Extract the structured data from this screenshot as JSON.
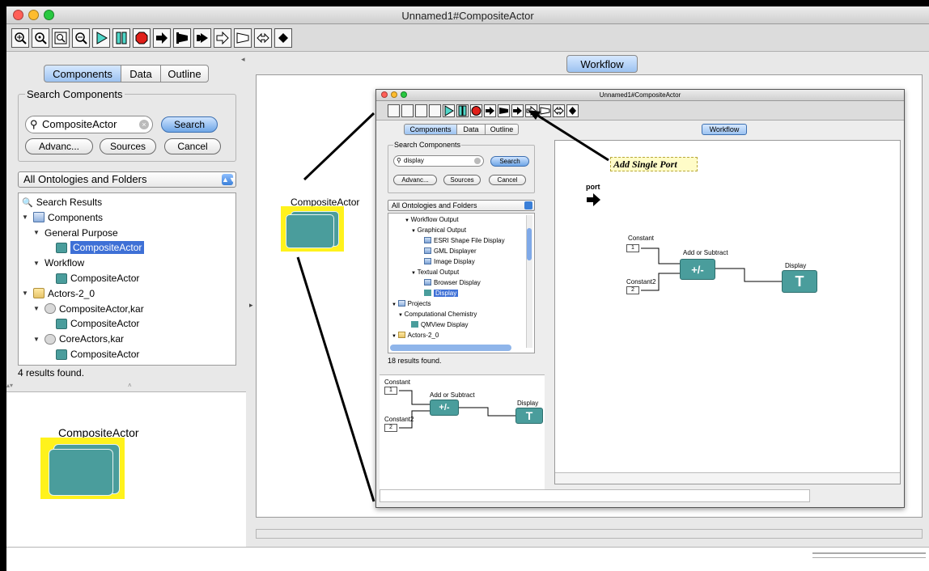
{
  "window": {
    "title": "Unnamed1#CompositeActor"
  },
  "toolbar": {
    "icons": [
      "zoom-in-icon",
      "zoom-reset-icon",
      "zoom-fit-icon",
      "zoom-out-icon",
      "run-icon",
      "pause-icon",
      "stop-icon",
      "add-single-port-icon",
      "add-input-port-icon",
      "add-output-port-icon",
      "add-multiport-icon",
      "add-input-multiport-icon",
      "add-io-port-icon",
      "add-relation-icon"
    ]
  },
  "left": {
    "tabs": [
      "Components",
      "Data",
      "Outline"
    ],
    "search": {
      "group_title": "Search Components",
      "value": "CompositeActor",
      "search_btn": "Search",
      "advanced_btn": "Advanc...",
      "sources_btn": "Sources",
      "cancel_btn": "Cancel"
    },
    "ontology": "All Ontologies and Folders",
    "tree": [
      {
        "label": "Search Results",
        "indent": 0,
        "icon": "search",
        "tri": ""
      },
      {
        "label": "Components",
        "indent": 0,
        "icon": "book",
        "tri": "▼"
      },
      {
        "label": "General Purpose",
        "indent": 1,
        "icon": "",
        "tri": "▼"
      },
      {
        "label": "CompositeActor",
        "indent": 3,
        "icon": "actor",
        "tri": "",
        "selected": true
      },
      {
        "label": "Workflow",
        "indent": 1,
        "icon": "",
        "tri": "▼"
      },
      {
        "label": "CompositeActor",
        "indent": 3,
        "icon": "actor",
        "tri": ""
      },
      {
        "label": "Actors-2_0",
        "indent": 0,
        "icon": "folder",
        "tri": "▼"
      },
      {
        "label": "CompositeActor,kar",
        "indent": 1,
        "icon": "kar",
        "tri": "▼"
      },
      {
        "label": "CompositeActor",
        "indent": 3,
        "icon": "actor",
        "tri": ""
      },
      {
        "label": "CoreActors,kar",
        "indent": 1,
        "icon": "kar",
        "tri": "▼"
      },
      {
        "label": "CompositeActor",
        "indent": 3,
        "icon": "actor",
        "tri": ""
      }
    ],
    "status": "4 results found.",
    "preview_label": "CompositeActor"
  },
  "workflow": {
    "tab": "Workflow",
    "canvas_actor_label": "CompositeActor"
  },
  "inner": {
    "title": "Unnamed1#CompositeActor",
    "tabs": [
      "Components",
      "Data",
      "Outline"
    ],
    "search": {
      "group_title": "Search Components",
      "value": "display",
      "search_btn": "Search",
      "advanced_btn": "Advanc...",
      "sources_btn": "Sources",
      "cancel_btn": "Cancel"
    },
    "ontology": "All Ontologies and Folders",
    "tree": [
      {
        "label": "Workflow Output",
        "indent": 2,
        "tri": "▼",
        "icon": ""
      },
      {
        "label": "Graphical Output",
        "indent": 3,
        "tri": "▼",
        "icon": ""
      },
      {
        "label": "ESRI Shape File Display",
        "indent": 5,
        "tri": "",
        "icon": "img"
      },
      {
        "label": "GML Displayer",
        "indent": 5,
        "tri": "",
        "icon": "img"
      },
      {
        "label": "Image Display",
        "indent": 5,
        "tri": "",
        "icon": "img"
      },
      {
        "label": "Textual Output",
        "indent": 3,
        "tri": "▼",
        "icon": ""
      },
      {
        "label": "Browser Display",
        "indent": 5,
        "tri": "",
        "icon": "img"
      },
      {
        "label": "Display",
        "indent": 5,
        "tri": "",
        "icon": "T",
        "selected": true
      },
      {
        "label": "Projects",
        "indent": 0,
        "tri": "▼",
        "icon": "book"
      },
      {
        "label": "Computational Chemistry",
        "indent": 1,
        "tri": "▼",
        "icon": ""
      },
      {
        "label": "QMView Display",
        "indent": 3,
        "tri": "",
        "icon": "actor"
      },
      {
        "label": "Actors-2_0",
        "indent": 0,
        "tri": "▼",
        "icon": "folder"
      }
    ],
    "status": "18 results found.",
    "workflow_tab": "Workflow",
    "annotation": "Add Single Port",
    "port_label": "port",
    "constant_label": "Constant",
    "constant_value": "1",
    "constant2_label": "Constant2",
    "constant2_value": "2",
    "adder_label": "Add or Subtract",
    "adder_symbol": "+/-",
    "display_label": "Display",
    "display_symbol": "T"
  }
}
